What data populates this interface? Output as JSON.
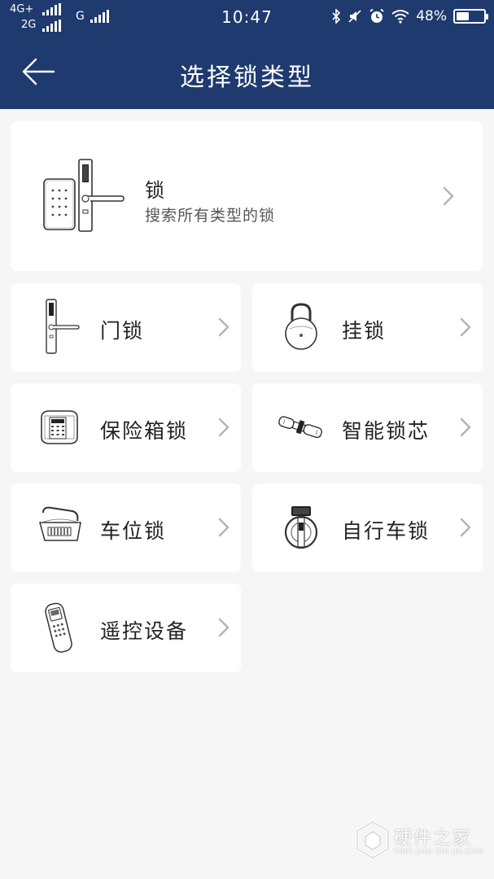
{
  "status_bar": {
    "network_top": "4G+",
    "network_bottom": "2G",
    "network_g": "G",
    "time": "10:47",
    "battery_text": "48%",
    "battery_level": 0.48,
    "icons": [
      "bluetooth-icon",
      "mute-icon",
      "alarm-icon",
      "wifi-icon",
      "battery-icon"
    ]
  },
  "header": {
    "title": "选择锁类型",
    "back_icon": "arrow-left-icon",
    "background": "#1e3a6e"
  },
  "main_card": {
    "title": "锁",
    "subtitle": "搜索所有类型的锁",
    "icon": "door-lock-keypad-icon"
  },
  "categories": [
    {
      "label": "门锁",
      "icon": "door-lock-icon"
    },
    {
      "label": "挂锁",
      "icon": "padlock-icon"
    },
    {
      "label": "保险箱锁",
      "icon": "safe-lock-icon"
    },
    {
      "label": "智能锁芯",
      "icon": "lock-cylinder-icon"
    },
    {
      "label": "车位锁",
      "icon": "parking-lock-icon"
    },
    {
      "label": "自行车锁",
      "icon": "bike-lock-icon"
    },
    {
      "label": "遥控设备",
      "icon": "remote-control-icon"
    }
  ],
  "watermark": {
    "text": "硬件之家",
    "sub": "YING JIAN ZHI JIA.COM"
  },
  "colors": {
    "accent": "#1e3a6e",
    "background": "#f6f6f6",
    "card": "#ffffff",
    "chevron": "#b5b5b5"
  }
}
